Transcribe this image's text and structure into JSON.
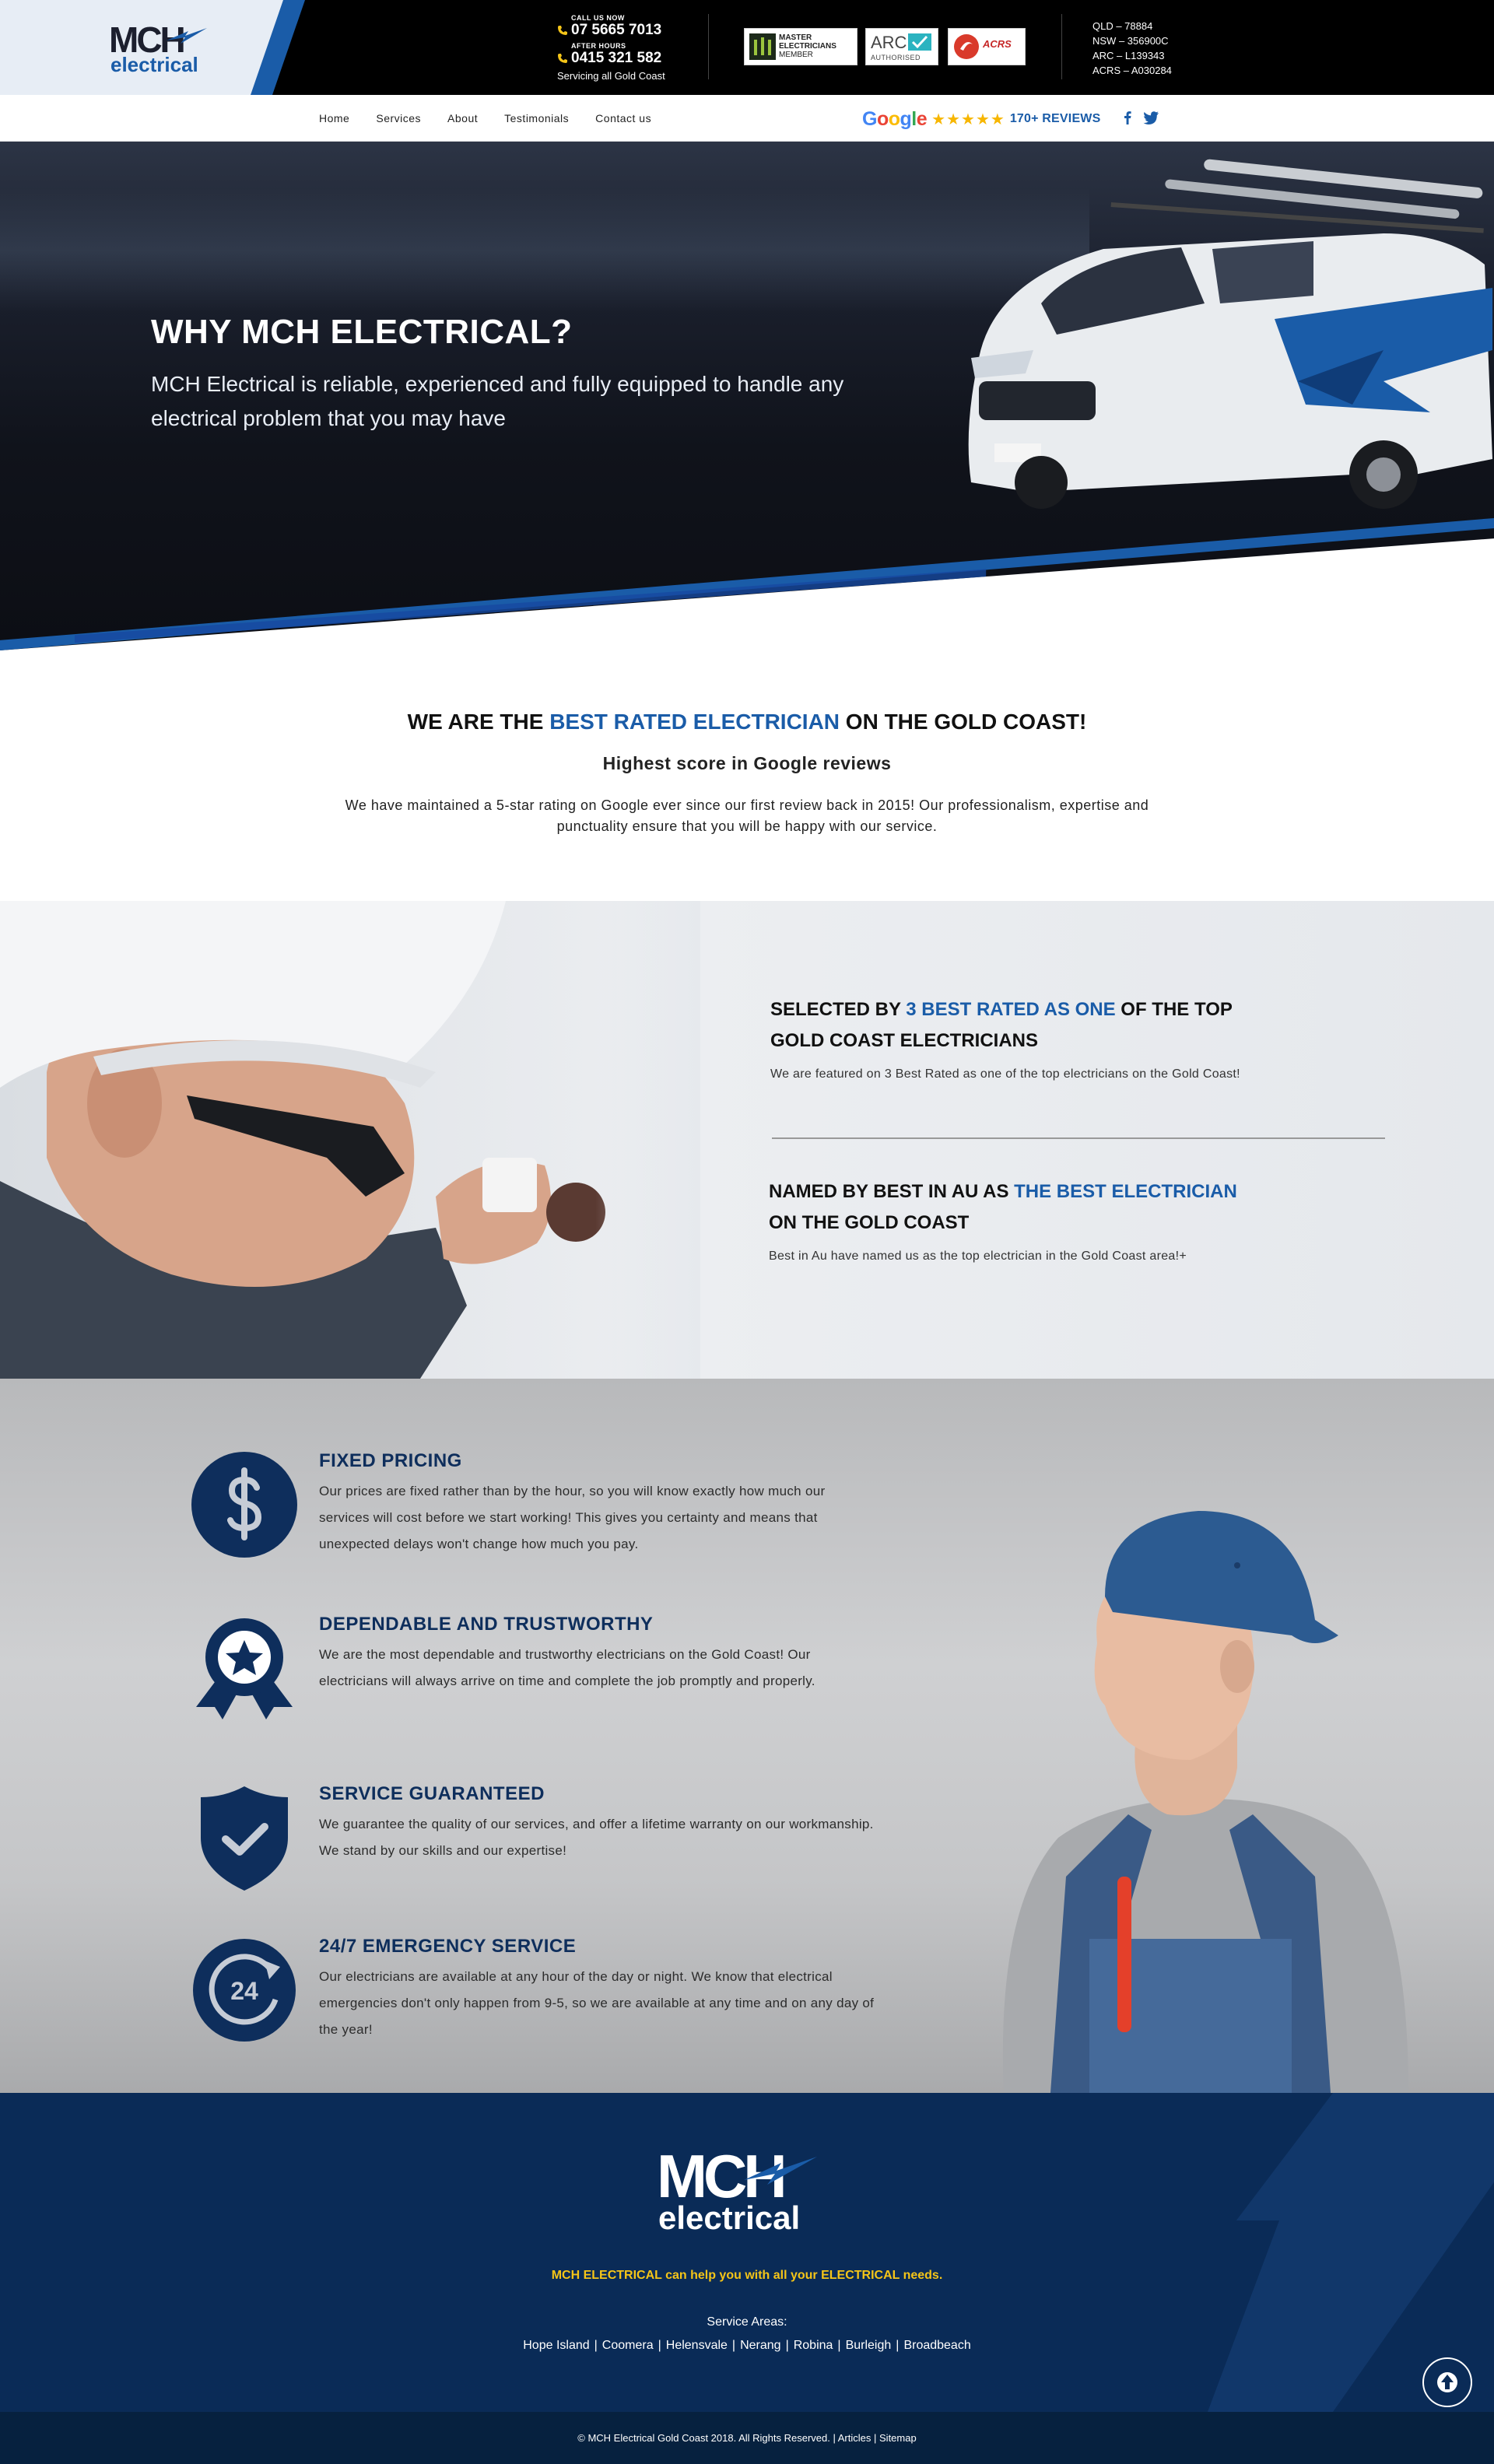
{
  "brand": {
    "logo_primary": "MCH",
    "logo_secondary": "electrical",
    "accent": "#1a5ca8",
    "navy": "#0e2e5c",
    "yellow": "#f5c518"
  },
  "topbar": {
    "call_label": "CALL US NOW",
    "call_number": "07 5665 7013",
    "after_label": "AFTER HOURS",
    "after_number": "0415 321 582",
    "servicing": "Servicing all Gold Coast",
    "badges": {
      "master_line1": "MASTER",
      "master_line2": "ELECTRICIANS",
      "master_line3": "MEMBER",
      "arc_name": "ARC",
      "arc_sub": "AUTHORISED",
      "acrs_name": "ACRS"
    },
    "licences": [
      "QLD – 78884",
      "NSW – 356900C",
      "ARC – L139343",
      "ACRS – A030284"
    ]
  },
  "nav": {
    "items": [
      "Home",
      "Services",
      "About",
      "Testimonials",
      "Contact us"
    ],
    "google_label": "Google",
    "stars": "★★★★★",
    "reviews": "170+ REVIEWS",
    "facebook_icon": "facebook-icon",
    "twitter_icon": "twitter-icon"
  },
  "hero": {
    "title": "WHY MCH ELECTRICAL?",
    "subtitle": "MCH Electrical is reliable, experienced and fully equipped to handle any electrical problem that you may have"
  },
  "rating": {
    "title_pre": "WE ARE THE ",
    "title_highlight": "BEST RATED ELECTRICIAN",
    "title_post": " ON THE GOLD COAST!",
    "subtitle": "Highest score in Google reviews",
    "text": "We have maintained a 5-star rating on Google ever since our first review back in 2015! Our professionalism, expertise and punctuality ensure that you will be happy with our service."
  },
  "featured": {
    "block1": {
      "title_pre": "SELECTED BY ",
      "title_highlight": "3 BEST RATED AS ONE",
      "title_post": " OF THE TOP",
      "title_line2": "GOLD COAST ELECTRICIANS",
      "text": "We are featured on 3 Best Rated as one of the top electricians on the Gold Coast!"
    },
    "block2": {
      "title_pre": "NAMED BY BEST IN AU AS ",
      "title_highlight": "THE BEST ELECTRICIAN",
      "title_line2": "ON THE GOLD COAST",
      "text": "Best in Au have named us as the top electrician in the Gold Coast area!+"
    }
  },
  "benefits": [
    {
      "icon": "dollar-icon",
      "title": "FIXED PRICING",
      "text": "Our prices are fixed rather than by the hour, so you will know exactly how much our services will cost before we start working! This gives you certainty and means that unexpected delays won't change how much you pay."
    },
    {
      "icon": "award-ribbon-icon",
      "title": "DEPENDABLE AND TRUSTWORTHY",
      "text": "We are the most dependable and trustworthy electricians on the Gold Coast! Our electricians will always arrive on time and complete the job promptly and properly."
    },
    {
      "icon": "shield-check-icon",
      "title": "SERVICE GUARANTEED",
      "text": "We guarantee the quality of our services, and offer a lifetime warranty on our workmanship. We stand by our skills and our expertise!"
    },
    {
      "icon": "clock-24-icon",
      "icon_label": "24",
      "title": "24/7 EMERGENCY SERVICE",
      "text": "Our electricians are available at any hour of the day or night. We know that electrical emergencies don't only happen from 9-5, so we are available at any time and on any day of the year!"
    }
  ],
  "footer": {
    "tagline": "MCH ELECTRICAL can help you with all your ELECTRICAL needs.",
    "areas_label": "Service Areas:",
    "areas": [
      "Hope Island",
      "Coomera",
      "Helensvale",
      "Nerang",
      "Robina",
      "Burleigh",
      "Broadbeach"
    ],
    "copyright": "© MCH Electrical Gold Coast 2018. All Rights Reserved.",
    "links": [
      "Articles",
      "Sitemap"
    ]
  }
}
